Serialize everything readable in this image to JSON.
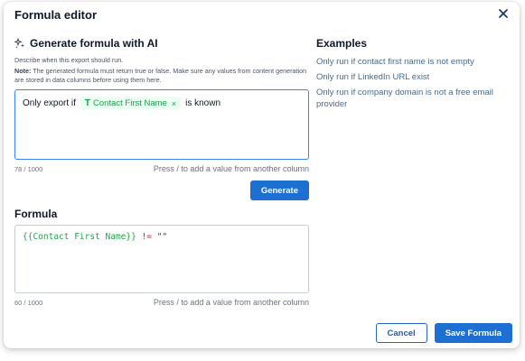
{
  "dialog": {
    "title": "Formula editor",
    "close_icon": "close-icon"
  },
  "ai_section": {
    "title": "Generate formula with AI",
    "icon": "sparkle-icon",
    "description": "Describe when this export should run.",
    "note_label": "Note:",
    "note_text": " The generated formula must return true or false. Make sure any values from content generation are stored in data columns before using them here.",
    "prompt_prefix": "Only export if",
    "chip_label": "Contact First Name",
    "chip_type_glyph": "T",
    "chip_remove_glyph": "×",
    "prompt_suffix": "is known",
    "counter": "78 / 1000",
    "hint": "Press / to add a value from another column",
    "generate_label": "Generate"
  },
  "formula_section": {
    "title": "Formula",
    "variable": "{{Contact First Name}}",
    "operator": "!=",
    "literal": "\"\"",
    "counter": "60 / 1000",
    "hint": "Press / to add a value from another column"
  },
  "examples": {
    "title": "Examples",
    "items": [
      {
        "label": "Only run if contact first name is not empty"
      },
      {
        "label": "Only run if LinkedIn URL exist"
      },
      {
        "label": "Only run if company domain is not a free email provider"
      }
    ]
  },
  "footer": {
    "cancel_label": "Cancel",
    "save_label": "Save Formula"
  },
  "colors": {
    "primary": "#1d6fd1",
    "chip_bg": "#ecfdf3",
    "chip_text": "#16a34a",
    "operator": "#dc2626",
    "focus_border": "#3b82f6"
  }
}
